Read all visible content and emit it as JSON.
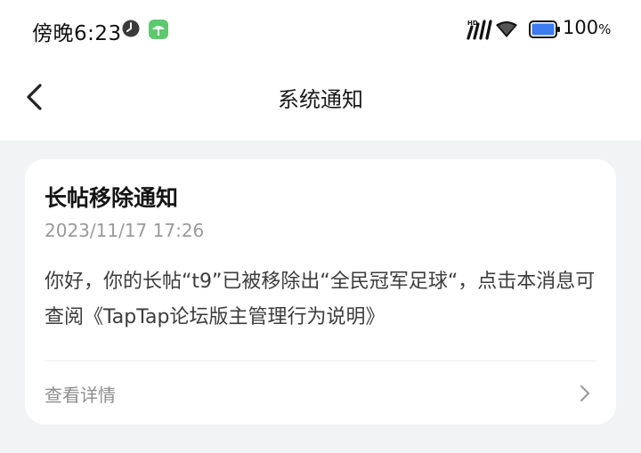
{
  "status_bar": {
    "time": "傍晚6:23",
    "battery_value": "100",
    "battery_unit": "%",
    "icons": [
      "clock-icon",
      "app-notification-icon",
      "hd-signal-icon",
      "battery-icon"
    ]
  },
  "nav": {
    "title": "系统通知",
    "back_icon": "chevron-left-icon"
  },
  "notification": {
    "title": "长帖移除通知",
    "timestamp": "2023/11/17 17:26",
    "body": "你好，你的长帖“t9”已被移除出“全民冠军足球“，点击本消息可查阅《TapTap论坛版主管理行为说明》",
    "detail_label": "查看详情",
    "detail_icon": "chevron-right-icon"
  },
  "colors": {
    "background": "#f2f3f5",
    "card": "#ffffff",
    "battery": "#3c7bf0",
    "app_icon": "#5cc96e"
  }
}
